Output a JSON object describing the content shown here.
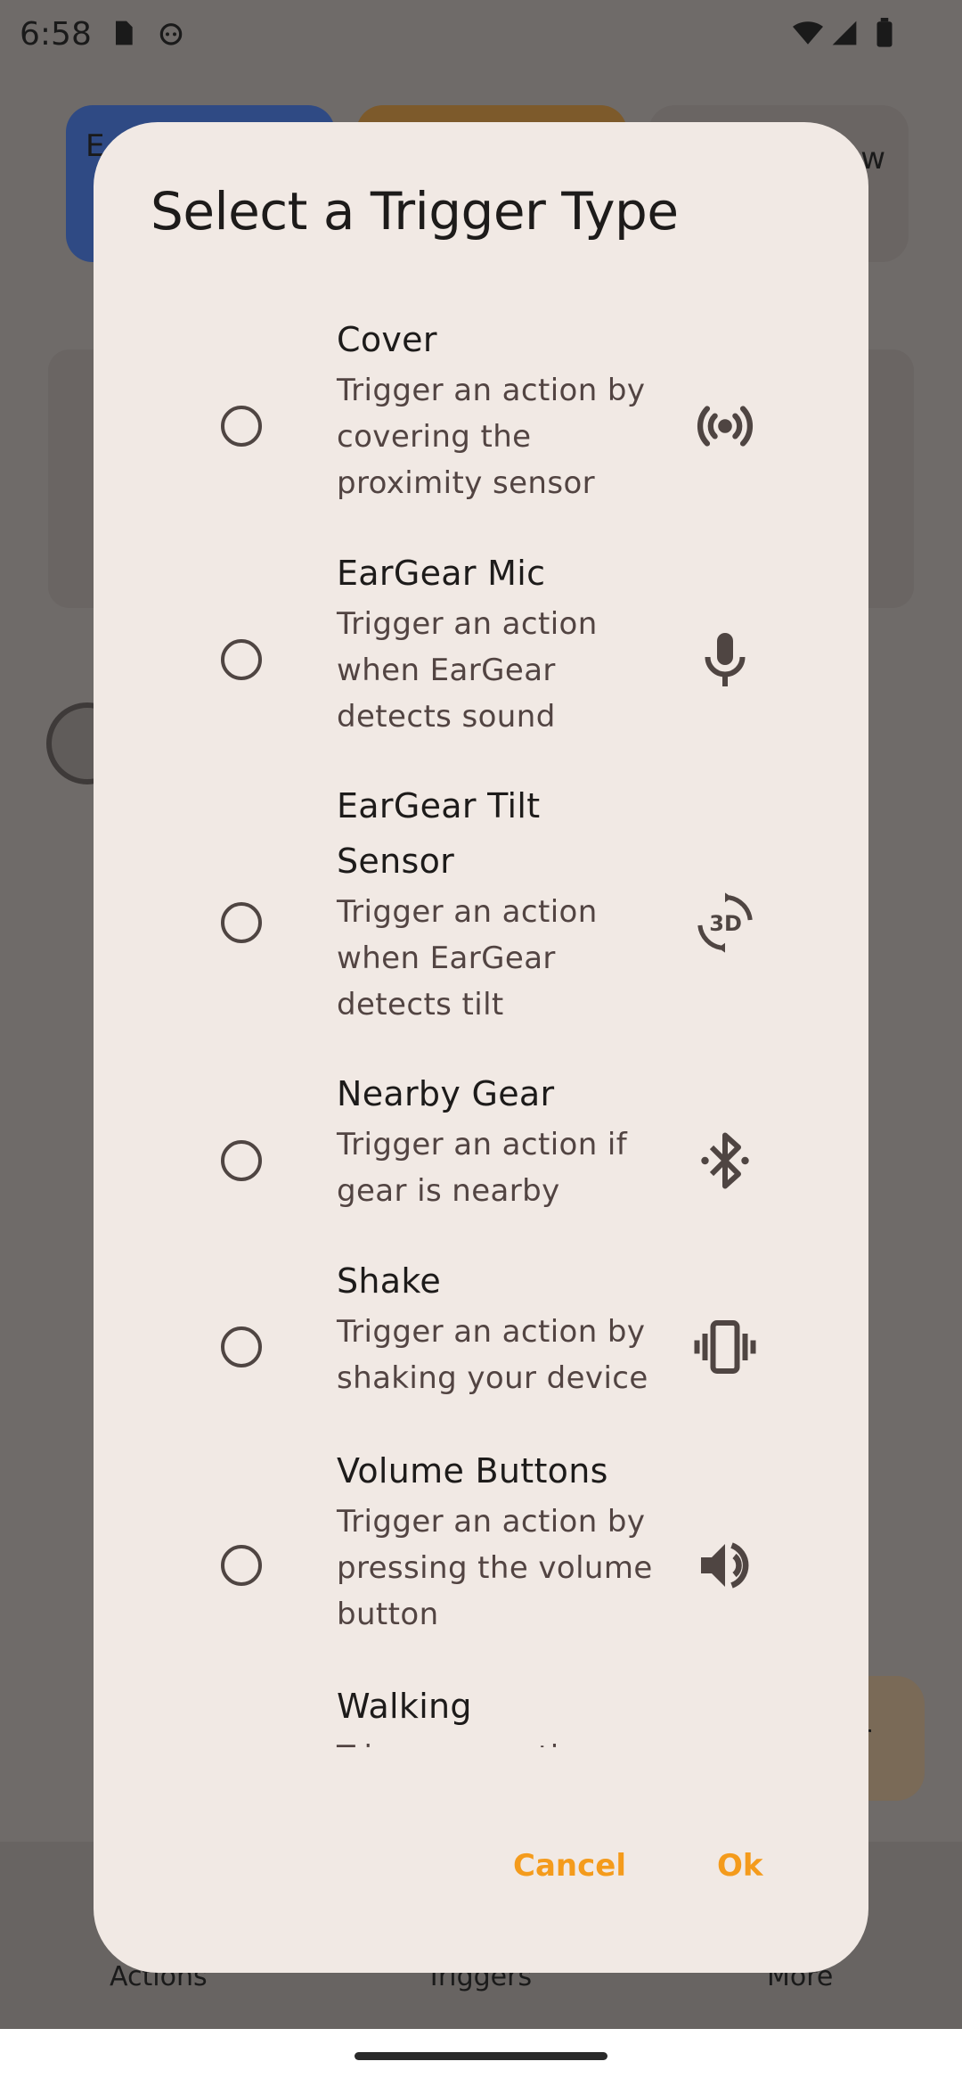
{
  "status_bar": {
    "time": "6:58"
  },
  "background": {
    "chip_1_label": "E",
    "chip_3_label": "w",
    "nav": [
      "Actions",
      "Triggers",
      "More"
    ],
    "fab_label": "r"
  },
  "dialog": {
    "title": "Select a Trigger Type",
    "options": [
      {
        "title": "Cover",
        "description": "Trigger an action by covering the proximity sensor",
        "icon": "proximity-sensor-icon"
      },
      {
        "title": "EarGear Mic",
        "description": "Trigger an action when EarGear detects sound",
        "icon": "mic-icon"
      },
      {
        "title": "EarGear Tilt Sensor",
        "description": "Trigger an action when EarGear detects tilt",
        "icon": "3d-rotation-icon"
      },
      {
        "title": "Nearby Gear",
        "description": "Trigger an action if gear is nearby",
        "icon": "bluetooth-searching-icon"
      },
      {
        "title": "Shake",
        "description": "Trigger an action by shaking your device",
        "icon": "vibration-icon"
      },
      {
        "title": "Volume Buttons",
        "description": "Trigger an action by pressing the volume button",
        "icon": "volume-up-icon"
      },
      {
        "title": "Walking",
        "description": "Trigger an action",
        "icon": "walking-icon"
      }
    ],
    "cancel_label": "Cancel",
    "ok_label": "Ok"
  },
  "colors": {
    "dialog_bg": "#f1e9e4",
    "accent": "#f49b1c",
    "scrim": "#6f6b69"
  }
}
